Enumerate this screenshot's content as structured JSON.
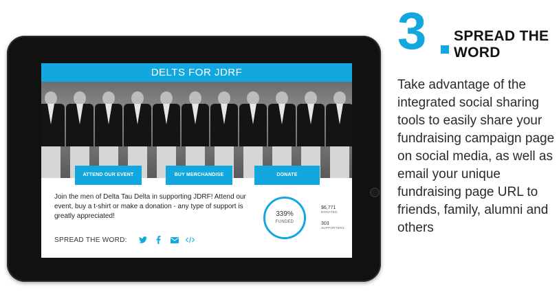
{
  "campaign": {
    "title": "DELTS FOR JDRF",
    "description": "Join the men of Delta Tau Delta in supporting JDRF! Attend our event, buy a t-shirt or make a donation - any type of support is greatly appreciated!",
    "spread_label": "SPREAD THE WORD:"
  },
  "actions": {
    "attend_event": "ATTEND OUR EVENT",
    "buy_merchandise": "BUY MERCHANDISE",
    "donate": "DONATE"
  },
  "progress": {
    "funded_percent": "339%",
    "funded_label": "FUNDED",
    "donated_value": "$6,771",
    "donated_label": "DONATED",
    "supporters_value": "303",
    "supporters_label": "SUPPORTERS"
  },
  "social_icons": [
    "twitter-icon",
    "facebook-icon",
    "email-icon",
    "embed-code-icon"
  ],
  "colors": {
    "accent": "#12a7df",
    "text": "#222222"
  },
  "step": {
    "number": "3",
    "title": "SPREAD THE WORD",
    "body": "Take advantage of the integrated social sharing tools to easily share your fundraising campaign page on social media, as well as email your unique fundraising page URL to friends, family, alumni and others"
  }
}
